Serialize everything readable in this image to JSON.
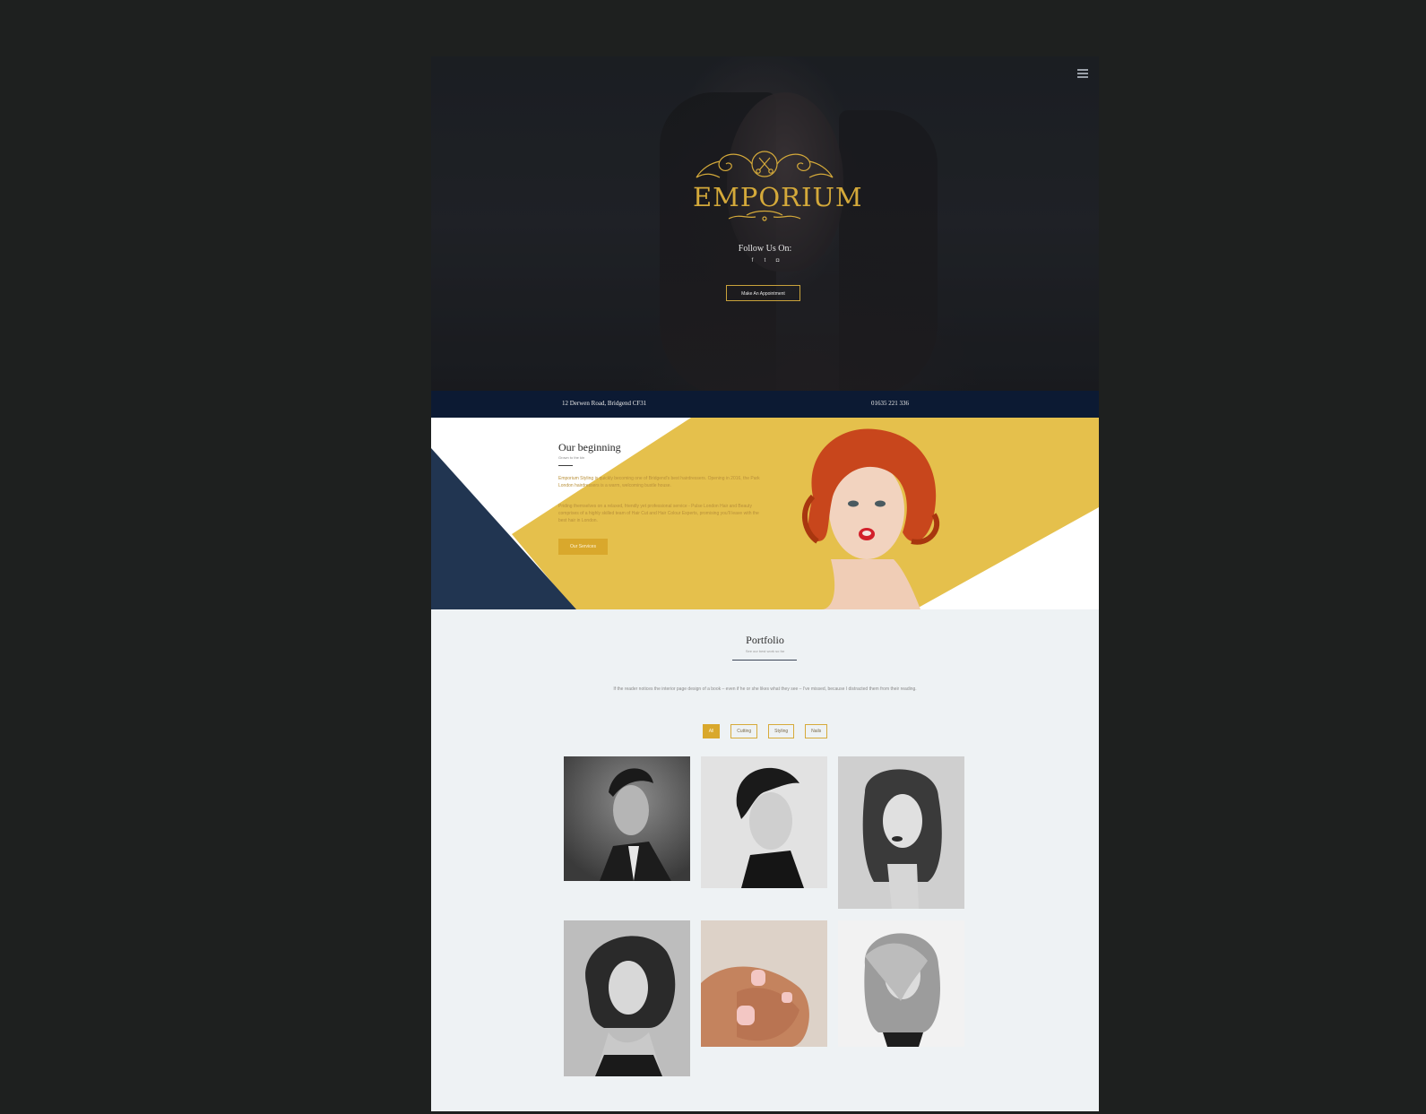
{
  "hero": {
    "logo_text": "EMPORIUM",
    "follow_label": "Follow Us On:",
    "socials": [
      {
        "icon": "facebook-icon",
        "glyph": "f"
      },
      {
        "icon": "twitter-icon",
        "glyph": "t"
      },
      {
        "icon": "instagram-icon",
        "glyph": "◘"
      }
    ],
    "appointment_label": "Make An Appointment"
  },
  "info_bar": {
    "address": "12 Derwen Road, Bridgend CF31",
    "phone": "01635 221 336"
  },
  "about": {
    "title": "Our beginning",
    "subtitle": "Grown to the kin",
    "paragraph_1": "Emporium Styling is quickly becoming one of Bridgend's best hairdressers. Opening in 2016, the Park London hairdressers is a warm, welcoming bustle house.",
    "paragraph_2": "Priding themselves on a relaxed, friendly yet professional service - Pulse London Hair and Beauty comprises of a highly skilled team of Hair Cut and Hair Colour Experts, promising you'll leave with the best hair in London.",
    "button_label": "Our Services"
  },
  "portfolio": {
    "title": "Portfolio",
    "subtitle": "See our best work so far",
    "description": "If the reader notices the interior page design of a book – even if he or she likes what they see – I've missed, because I distracted them from their reading.",
    "filters": [
      "All",
      "Cutting",
      "Styling",
      "Nails"
    ],
    "active_filter": "All"
  },
  "colors": {
    "gold": "#d9a82c",
    "yellow": "#e5c04c",
    "navy": "#213551",
    "info_bar": "#0c1a33",
    "page_bg": "#eef2f4",
    "outer_bg": "#1e201f"
  }
}
